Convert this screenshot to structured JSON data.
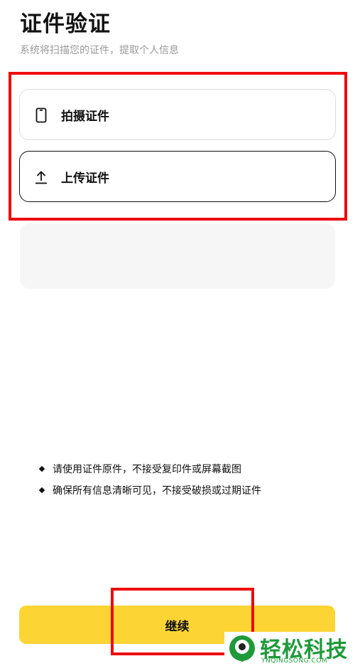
{
  "header": {
    "title": "证件验证",
    "subtitle": "系统将扫描您的证件，提取个人信息"
  },
  "options": [
    {
      "label": "拍摄证件",
      "icon": "phone-icon"
    },
    {
      "label": "上传证件",
      "icon": "upload-icon"
    }
  ],
  "notes": [
    "请使用证件原件，不接受复印件或屏幕截图",
    "确保所有信息清晰可见，不接受破损或过期证件"
  ],
  "footer": {
    "continue_label": "继续"
  },
  "watermark": {
    "text": "轻松科技",
    "sub": "YNQINGSONG.COM"
  },
  "colors": {
    "accent": "#fcd535",
    "annotation": "#ee0a0a",
    "watermark": "#1e9a3a"
  }
}
